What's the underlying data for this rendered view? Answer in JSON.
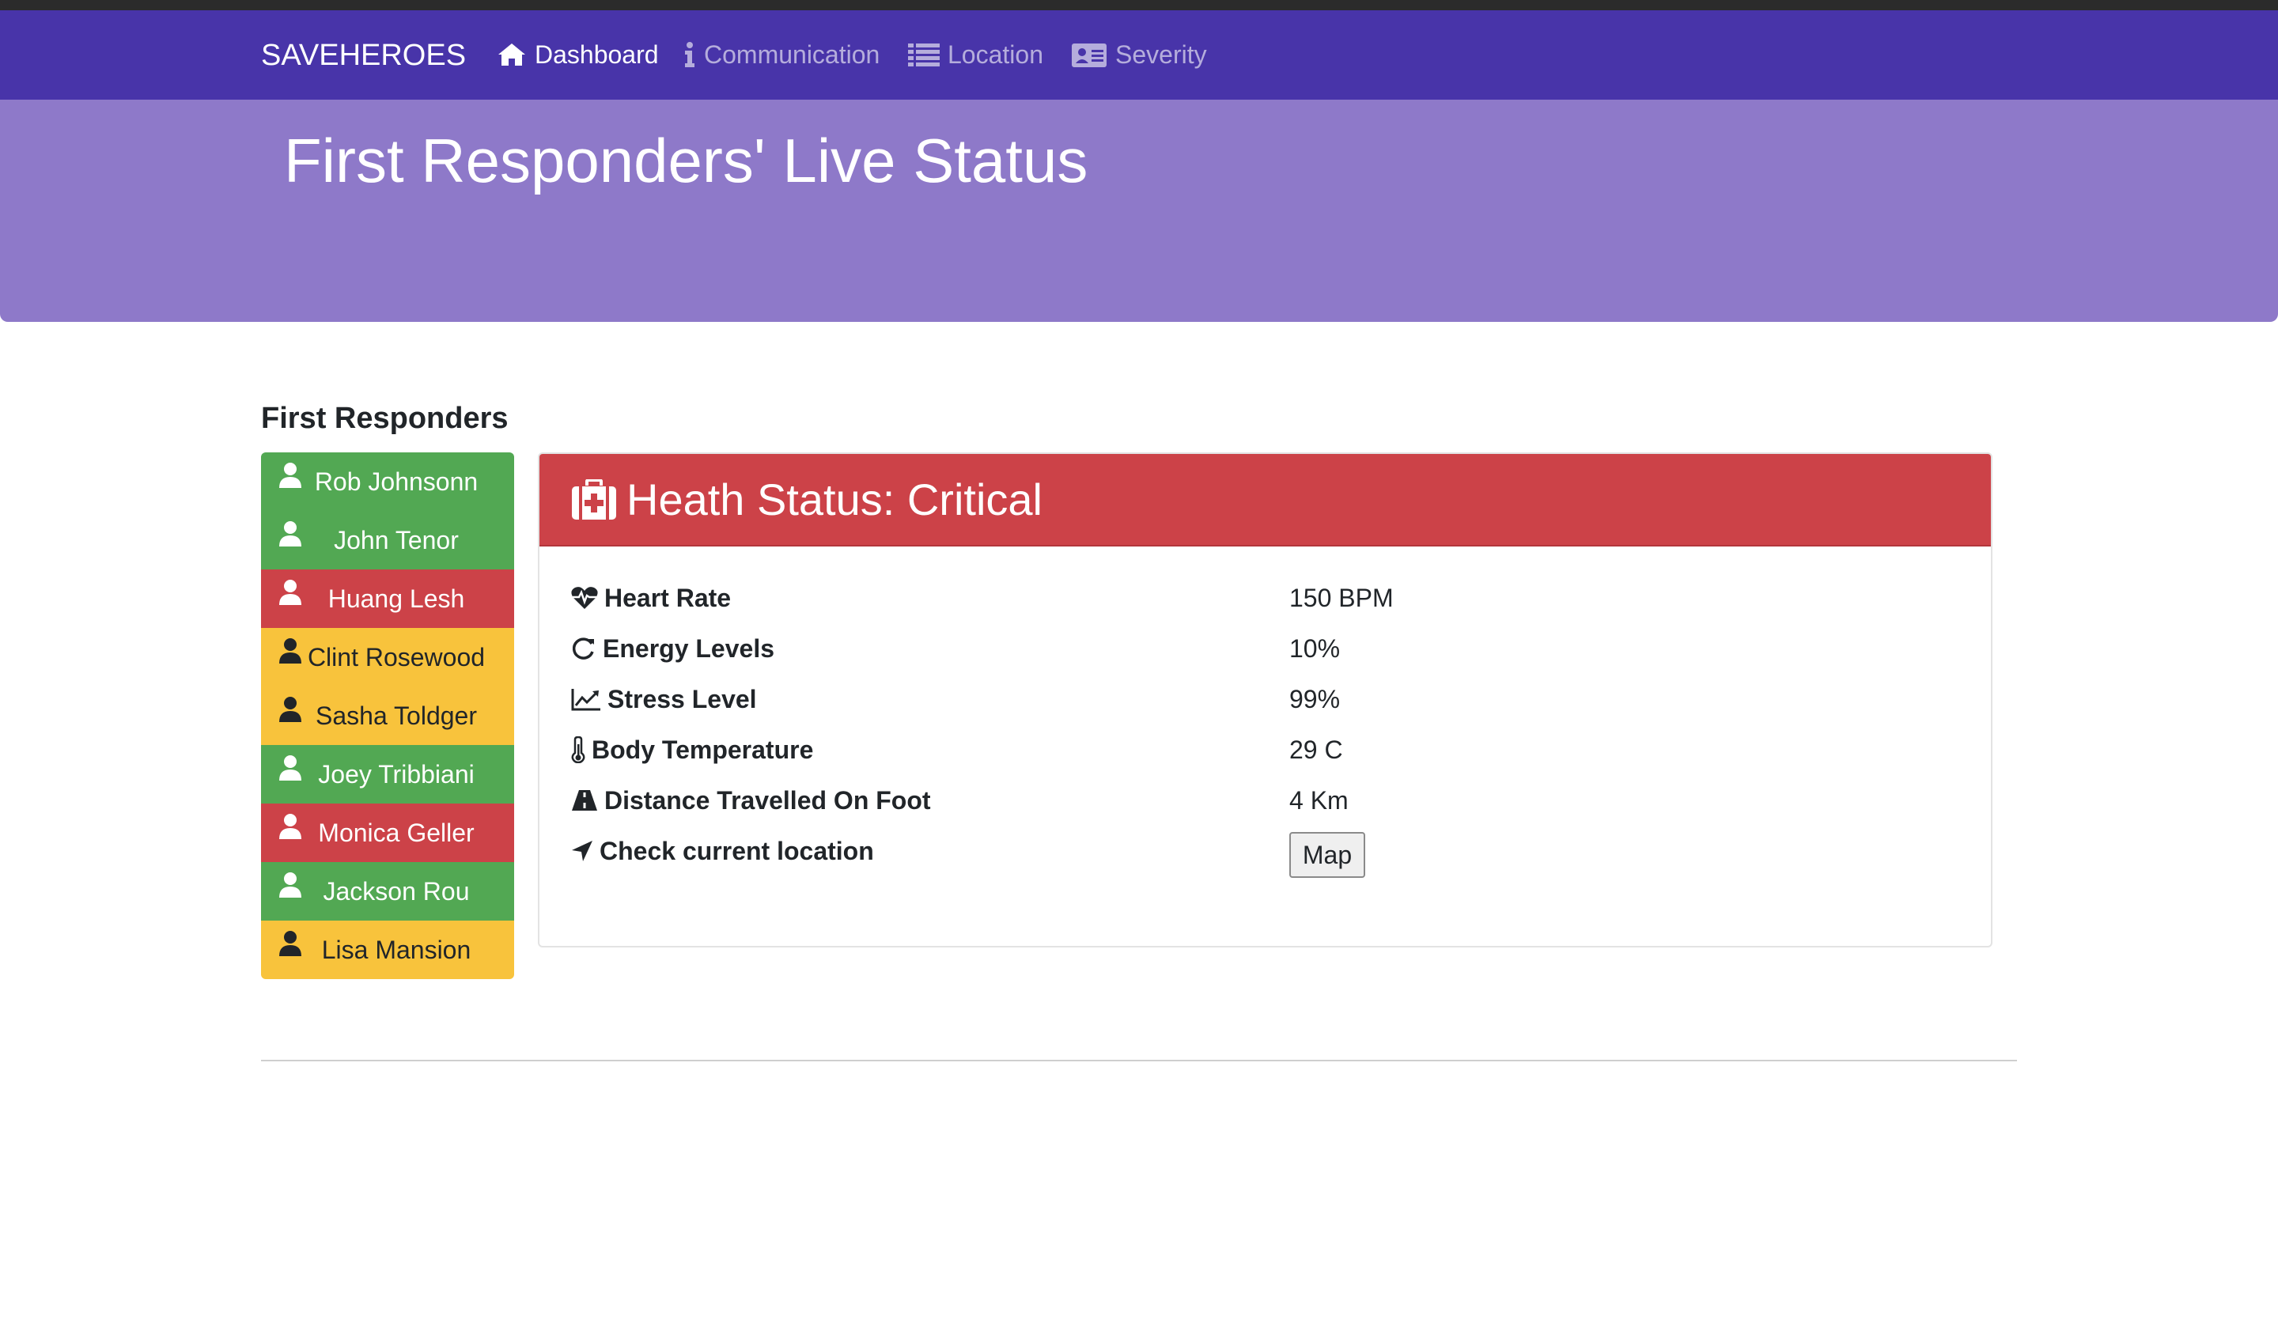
{
  "navbar": {
    "brand": "SAVEHEROES",
    "items": [
      {
        "label": "Dashboard",
        "icon": "home-icon",
        "active": true
      },
      {
        "label": "Communication",
        "icon": "info-icon",
        "active": false
      },
      {
        "label": "Location",
        "icon": "list-icon",
        "active": false
      },
      {
        "label": "Severity",
        "icon": "id-card-icon",
        "active": false
      }
    ]
  },
  "jumbotron": {
    "title": "First Responders' Live Status"
  },
  "responders": {
    "title": "First Responders",
    "items": [
      {
        "name": "Rob Johnsonn",
        "status": "green"
      },
      {
        "name": "John Tenor",
        "status": "green"
      },
      {
        "name": "Huang Lesh",
        "status": "red"
      },
      {
        "name": "Clint Rosewood",
        "status": "yellow"
      },
      {
        "name": "Sasha Toldger",
        "status": "yellow"
      },
      {
        "name": "Joey Tribbiani",
        "status": "green"
      },
      {
        "name": "Monica Geller",
        "status": "red"
      },
      {
        "name": "Jackson Rou",
        "status": "green"
      },
      {
        "name": "Lisa Mansion",
        "status": "yellow"
      }
    ]
  },
  "health": {
    "title": "Heath Status: Critical",
    "rows": [
      {
        "label": "Heart Rate",
        "value": "150 BPM",
        "icon": "heartbeat-icon"
      },
      {
        "label": "Energy Levels",
        "value": "10%",
        "icon": "refresh-icon"
      },
      {
        "label": "Stress Level",
        "value": "99%",
        "icon": "line-chart-icon"
      },
      {
        "label": "Body Temperature",
        "value": "29 C",
        "icon": "thermometer-icon"
      },
      {
        "label": "Distance Travelled On Foot",
        "value": "4 Km",
        "icon": "road-icon"
      },
      {
        "label": "Check current location",
        "icon": "location-arrow-icon"
      }
    ],
    "map_button": "Map"
  },
  "colors": {
    "navbar": "#4834a9",
    "jumbotron": "#8e79c9",
    "critical": "#cc4248",
    "good": "#52a853",
    "warning": "#f8c33c"
  }
}
